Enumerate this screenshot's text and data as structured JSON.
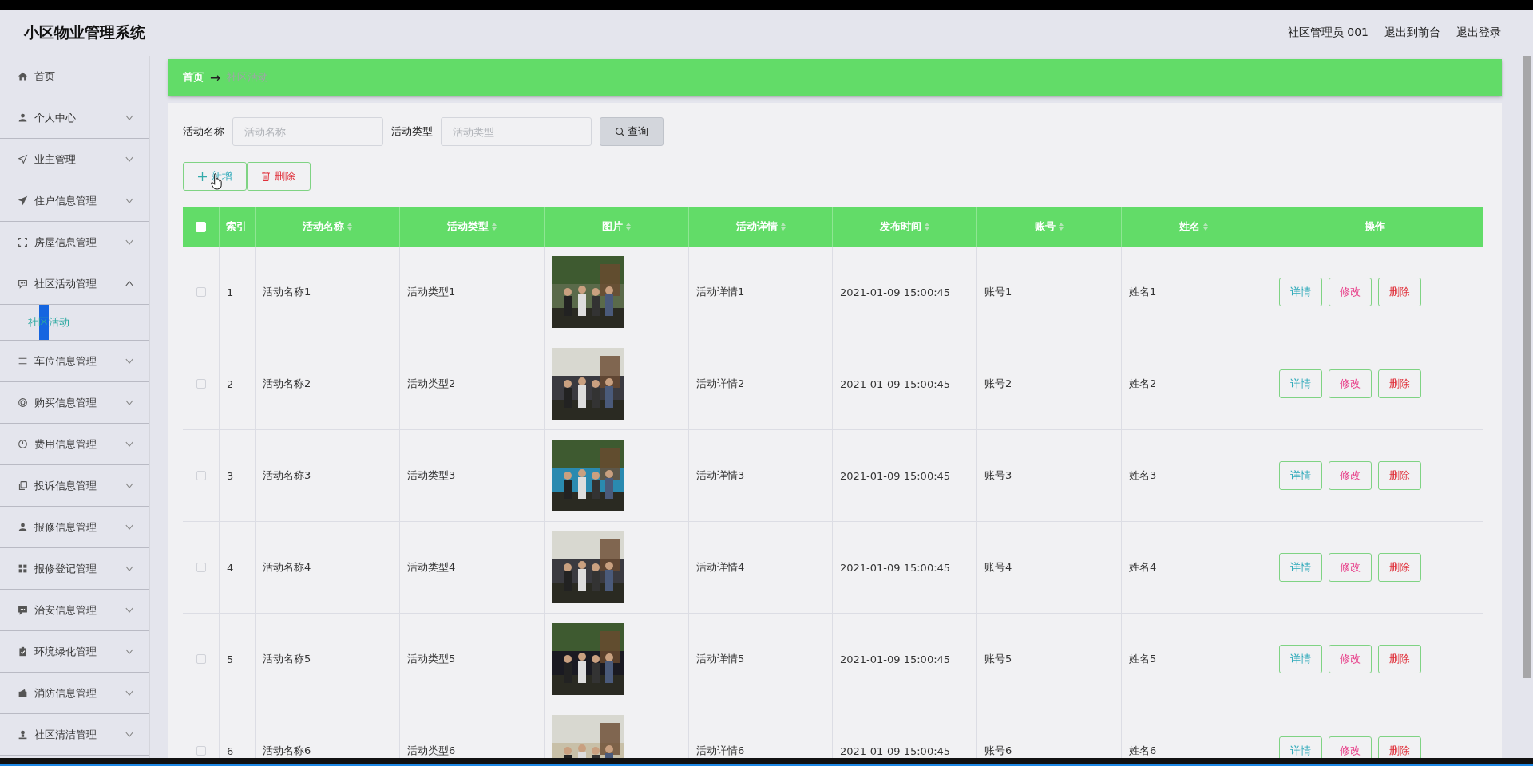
{
  "header": {
    "title": "小区物业管理系统",
    "user": "社区管理员 001",
    "links": [
      "退出到前台",
      "退出登录"
    ]
  },
  "sidebar": {
    "items": [
      {
        "label": "首页",
        "kind": "link"
      },
      {
        "label": "个人中心",
        "kind": "menu",
        "expanded": false
      },
      {
        "label": "业主管理",
        "kind": "menu",
        "expanded": false
      },
      {
        "label": "住户信息管理",
        "kind": "menu",
        "expanded": false
      },
      {
        "label": "房屋信息管理",
        "kind": "menu",
        "expanded": false
      },
      {
        "label": "社区活动管理",
        "kind": "menu",
        "expanded": true,
        "children": [
          {
            "label": "社区活动",
            "selected": true
          }
        ]
      },
      {
        "label": "车位信息管理",
        "kind": "menu",
        "expanded": false
      },
      {
        "label": "购买信息管理",
        "kind": "menu",
        "expanded": false
      },
      {
        "label": "费用信息管理",
        "kind": "menu",
        "expanded": false
      },
      {
        "label": "投诉信息管理",
        "kind": "menu",
        "expanded": false
      },
      {
        "label": "报修信息管理",
        "kind": "menu",
        "expanded": false
      },
      {
        "label": "报修登记管理",
        "kind": "menu",
        "expanded": false
      },
      {
        "label": "治安信息管理",
        "kind": "menu",
        "expanded": false
      },
      {
        "label": "环境绿化管理",
        "kind": "menu",
        "expanded": false
      },
      {
        "label": "消防信息管理",
        "kind": "menu",
        "expanded": false
      },
      {
        "label": "社区清洁管理",
        "kind": "menu",
        "expanded": false
      }
    ]
  },
  "breadcrumb": {
    "home": "首页",
    "separator": "→",
    "current": "社区活动"
  },
  "search": {
    "fields": [
      {
        "label": "活动名称",
        "placeholder": "活动名称"
      },
      {
        "label": "活动类型",
        "placeholder": "活动类型"
      }
    ],
    "button": "查询"
  },
  "toolbar": {
    "add": "新增",
    "delete": "删除"
  },
  "table": {
    "columns": [
      {
        "label": "索引",
        "sortable": false
      },
      {
        "label": "活动名称",
        "sortable": true
      },
      {
        "label": "活动类型",
        "sortable": true
      },
      {
        "label": "图片",
        "sortable": true
      },
      {
        "label": "活动详情",
        "sortable": true
      },
      {
        "label": "发布时间",
        "sortable": true
      },
      {
        "label": "账号",
        "sortable": true
      },
      {
        "label": "姓名",
        "sortable": true
      },
      {
        "label": "操作",
        "sortable": false
      }
    ],
    "all_checked": false,
    "rows": [
      {
        "checked": false,
        "index": "1",
        "name": "活动名称1",
        "type": "活动类型1",
        "detail": "活动详情1",
        "time": "2021-01-09 15:00:45",
        "account": "账号1",
        "person": "姓名1",
        "actions": [
          "详情",
          "修改",
          "删除"
        ]
      },
      {
        "checked": false,
        "index": "2",
        "name": "活动名称2",
        "type": "活动类型2",
        "detail": "活动详情2",
        "time": "2021-01-09 15:00:45",
        "account": "账号2",
        "person": "姓名2",
        "actions": [
          "详情",
          "修改",
          "删除"
        ]
      },
      {
        "checked": false,
        "index": "3",
        "name": "活动名称3",
        "type": "活动类型3",
        "detail": "活动详情3",
        "time": "2021-01-09 15:00:45",
        "account": "账号3",
        "person": "姓名3",
        "actions": [
          "详情",
          "修改",
          "删除"
        ]
      },
      {
        "checked": false,
        "index": "4",
        "name": "活动名称4",
        "type": "活动类型4",
        "detail": "活动详情4",
        "time": "2021-01-09 15:00:45",
        "account": "账号4",
        "person": "姓名4",
        "actions": [
          "详情",
          "修改",
          "删除"
        ]
      },
      {
        "checked": false,
        "index": "5",
        "name": "活动名称5",
        "type": "活动类型5",
        "detail": "活动详情5",
        "time": "2021-01-09 15:00:45",
        "account": "账号5",
        "person": "姓名5",
        "actions": [
          "详情",
          "修改",
          "删除"
        ]
      },
      {
        "checked": false,
        "index": "6",
        "name": "活动名称6",
        "type": "活动类型6",
        "detail": "活动详情6",
        "time": "2021-01-09 15:00:45",
        "account": "账号6",
        "person": "姓名6",
        "actions": [
          "详情",
          "修改",
          "删除"
        ]
      }
    ]
  }
}
